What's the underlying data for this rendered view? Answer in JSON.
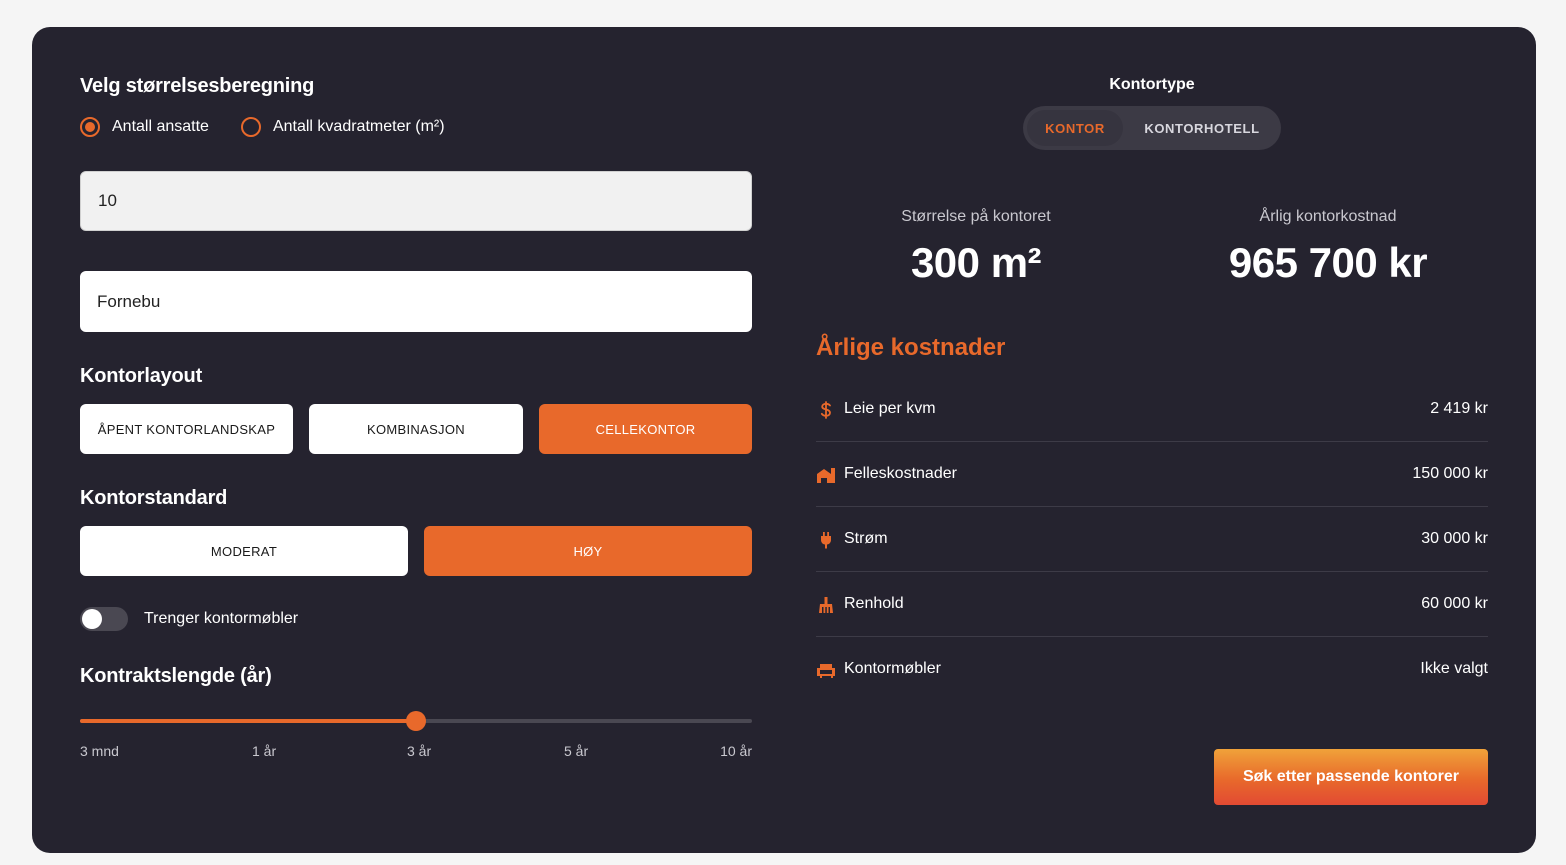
{
  "left": {
    "size_calc_title": "Velg størrelsesberegning",
    "radio_options": [
      {
        "label": "Antall ansatte",
        "checked": true
      },
      {
        "label": "Antall kvadratmeter (m²)",
        "checked": false
      }
    ],
    "employee_input_value": "10",
    "location_input_value": "Fornebu",
    "layout_title": "Kontorlayout",
    "layout_options": [
      {
        "label": "ÅPENT KONTORLANDSKAP",
        "active": false
      },
      {
        "label": "KOMBINASJON",
        "active": false
      },
      {
        "label": "CELLEKONTOR",
        "active": true
      }
    ],
    "standard_title": "Kontorstandard",
    "standard_options": [
      {
        "label": "MODERAT",
        "active": false
      },
      {
        "label": "HØY",
        "active": true
      }
    ],
    "furniture_toggle_label": "Trenger kontormøbler",
    "furniture_toggle_on": false,
    "contract_title": "Kontraktslengde (år)",
    "contract_ticks": [
      "3 mnd",
      "1 år",
      "3 år",
      "5 år",
      "10 år"
    ],
    "contract_selected_index": 2
  },
  "right": {
    "type_title": "Kontortype",
    "type_options": [
      {
        "label": "KONTOR",
        "active": true
      },
      {
        "label": "KONTORHOTELL",
        "active": false
      }
    ],
    "size_label": "Størrelse på kontoret",
    "size_value": "300 m²",
    "cost_label": "Årlig kontorkostnad",
    "cost_value": "965 700 kr",
    "costs_title": "Årlige kostnader",
    "cost_rows": [
      {
        "icon": "dollar-icon",
        "label": "Leie per kvm",
        "value": "2 419 kr"
      },
      {
        "icon": "buildings-icon",
        "label": "Felleskostnader",
        "value": "150 000 kr"
      },
      {
        "icon": "plug-icon",
        "label": "Strøm",
        "value": "30 000 kr"
      },
      {
        "icon": "broom-icon",
        "label": "Renhold",
        "value": "60 000 kr"
      },
      {
        "icon": "armchair-icon",
        "label": "Kontormøbler",
        "value": "Ikke valgt"
      }
    ],
    "cta_label": "Søk etter passende kontorer"
  },
  "colors": {
    "panel": "#25232f",
    "accent": "#e8692b",
    "page_bg": "#f5f5f5"
  }
}
